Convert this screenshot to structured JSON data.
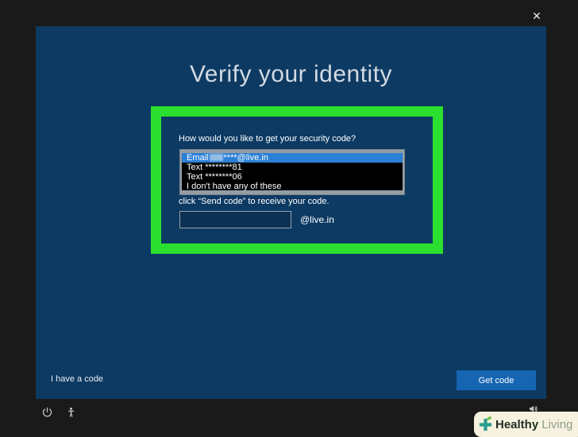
{
  "window": {
    "close_icon": "✕"
  },
  "panel": {
    "title": "Verify your identity",
    "dialog": {
      "question": "How would you like to get your security code?",
      "dropdown": {
        "selected": {
          "prefix": "Email",
          "suffix": "****@live.in"
        },
        "options": [
          "Text ********81",
          "Text ********06",
          "I don't have any of these"
        ]
      },
      "instruction": "click “Send code” to receive your code.",
      "code_input": {
        "value": "",
        "placeholder": ""
      },
      "domain_suffix": "@live.in"
    },
    "footer": {
      "have_code_link": "I have a code",
      "get_code_button": "Get code"
    }
  },
  "tray": {
    "icons": [
      "power-icon",
      "ease-of-access-icon",
      "audio-icon"
    ]
  },
  "watermark": {
    "brand_bold": "Healthy",
    "brand_light": "Living"
  },
  "colors": {
    "background": "#1a1a1a",
    "panel_blue": "#0d3a63",
    "highlight_green": "#2bdf2e",
    "selection_blue": "#2b7fd6",
    "button_blue": "#1565b2",
    "watermark_cream": "#f7f2df"
  }
}
